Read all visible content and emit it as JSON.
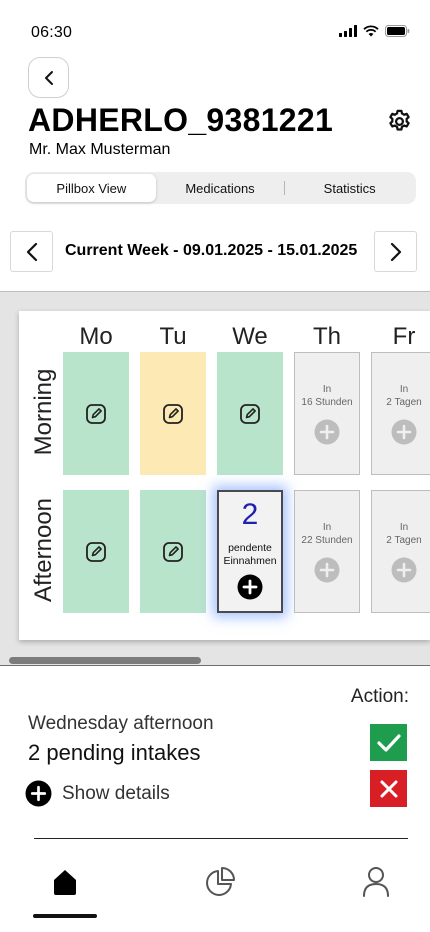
{
  "status_bar": {
    "time": "06:30"
  },
  "header": {
    "patient_id": "ADHERLO_9381221",
    "patient_name": "Mr. Max Musterman"
  },
  "tabs": [
    {
      "label": "Pillbox View",
      "active": true
    },
    {
      "label": "Medications",
      "active": false
    },
    {
      "label": "Statistics",
      "active": false
    }
  ],
  "week": {
    "label": "Current Week -  09.01.2025 - 15.01.2025"
  },
  "calendar": {
    "days": [
      "Mo",
      "Tu",
      "We",
      "Th",
      "Fr"
    ],
    "rows": [
      "Morning",
      "Afternoon"
    ],
    "morning": [
      {
        "state": "taken",
        "icon": "edit-icon"
      },
      {
        "state": "partial",
        "icon": "edit-icon"
      },
      {
        "state": "taken",
        "icon": "edit-icon"
      },
      {
        "state": "future",
        "line1": "In",
        "line2": "16 Stunden",
        "icon": "plus-circle-icon"
      },
      {
        "state": "future",
        "line1": "In",
        "line2": "2 Tagen",
        "icon": "plus-circle-icon"
      }
    ],
    "afternoon": [
      {
        "state": "taken",
        "icon": "edit-icon"
      },
      {
        "state": "taken",
        "icon": "edit-icon"
      },
      {
        "state": "pending",
        "count": "2",
        "line1": "pendente",
        "line2": "Einnahmen",
        "icon": "plus-circle-icon"
      },
      {
        "state": "future",
        "line1": "In",
        "line2": "22 Stunden",
        "icon": "plus-circle-icon"
      },
      {
        "state": "future",
        "line1": "In",
        "line2": "2 Tagen",
        "icon": "plus-circle-icon"
      }
    ]
  },
  "action_panel": {
    "action_label": "Action:",
    "slot_title": "Wednesday afternoon",
    "pending_text": "2 pending intakes",
    "show_details": "Show details"
  },
  "bottom_nav": [
    {
      "icon": "home-icon",
      "active": true
    },
    {
      "icon": "pie-chart-icon",
      "active": false
    },
    {
      "icon": "profile-icon",
      "active": false
    }
  ],
  "colors": {
    "taken": "#b9e4cc",
    "partial": "#fde9b3",
    "future": "#efefef",
    "pending_count": "#2020b0",
    "accept": "#1f9d4e",
    "reject": "#d81f26"
  }
}
